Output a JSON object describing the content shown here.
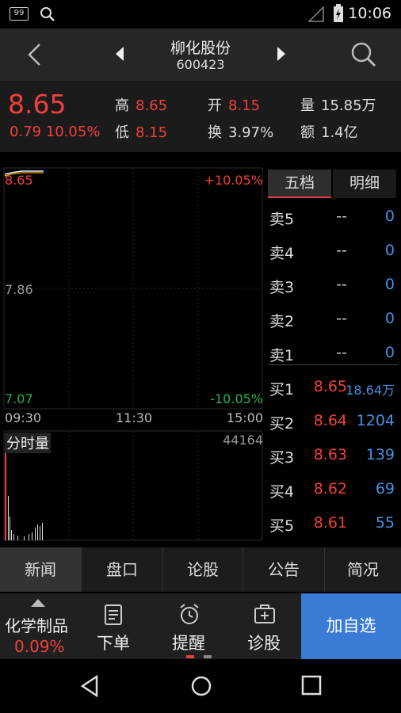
{
  "status": {
    "notif_badge": "99",
    "time": "10:06"
  },
  "header": {
    "title": "柳化股份",
    "code": "600423"
  },
  "quote": {
    "price": "8.65",
    "change": "0.79 10.05%",
    "high_label": "高",
    "high": "8.65",
    "low_label": "低",
    "low": "8.15",
    "open_label": "开",
    "open": "8.15",
    "turnover_label": "换",
    "turnover": "3.97%",
    "volume_label": "量",
    "volume": "15.85万",
    "amount_label": "额",
    "amount": "1.4亿"
  },
  "chart": {
    "price_top": "8.65",
    "pct_top": "+10.05%",
    "price_mid": "7.86",
    "price_bottom": "7.07",
    "pct_bottom": "-10.05%",
    "time_start": "09:30",
    "time_mid": "11:30",
    "time_end": "15:00",
    "vol_label": "分时量",
    "vol_max": "44164"
  },
  "book": {
    "tabs": [
      "五档",
      "明细"
    ],
    "asks": [
      {
        "label": "卖5",
        "price": "--",
        "volume": "0"
      },
      {
        "label": "卖4",
        "price": "--",
        "volume": "0"
      },
      {
        "label": "卖3",
        "price": "--",
        "volume": "0"
      },
      {
        "label": "卖2",
        "price": "--",
        "volume": "0"
      },
      {
        "label": "卖1",
        "price": "--",
        "volume": "0"
      }
    ],
    "bids": [
      {
        "label": "买1",
        "price": "8.65",
        "volume": "18.64万"
      },
      {
        "label": "买2",
        "price": "8.64",
        "volume": "1204"
      },
      {
        "label": "买3",
        "price": "8.63",
        "volume": "139"
      },
      {
        "label": "买4",
        "price": "8.62",
        "volume": "69"
      },
      {
        "label": "买5",
        "price": "8.61",
        "volume": "55"
      }
    ]
  },
  "tabs": [
    "新闻",
    "盘口",
    "论股",
    "公告",
    "简况"
  ],
  "actionbar": {
    "sector_name": "化学制品",
    "sector_pct": "0.09%",
    "order": "下单",
    "alert": "提醒",
    "diagnose": "诊股",
    "add": "加自选"
  },
  "colors": {
    "up": "#f0403a",
    "down": "#2bb24c",
    "accent": "#3a7bd5"
  }
}
